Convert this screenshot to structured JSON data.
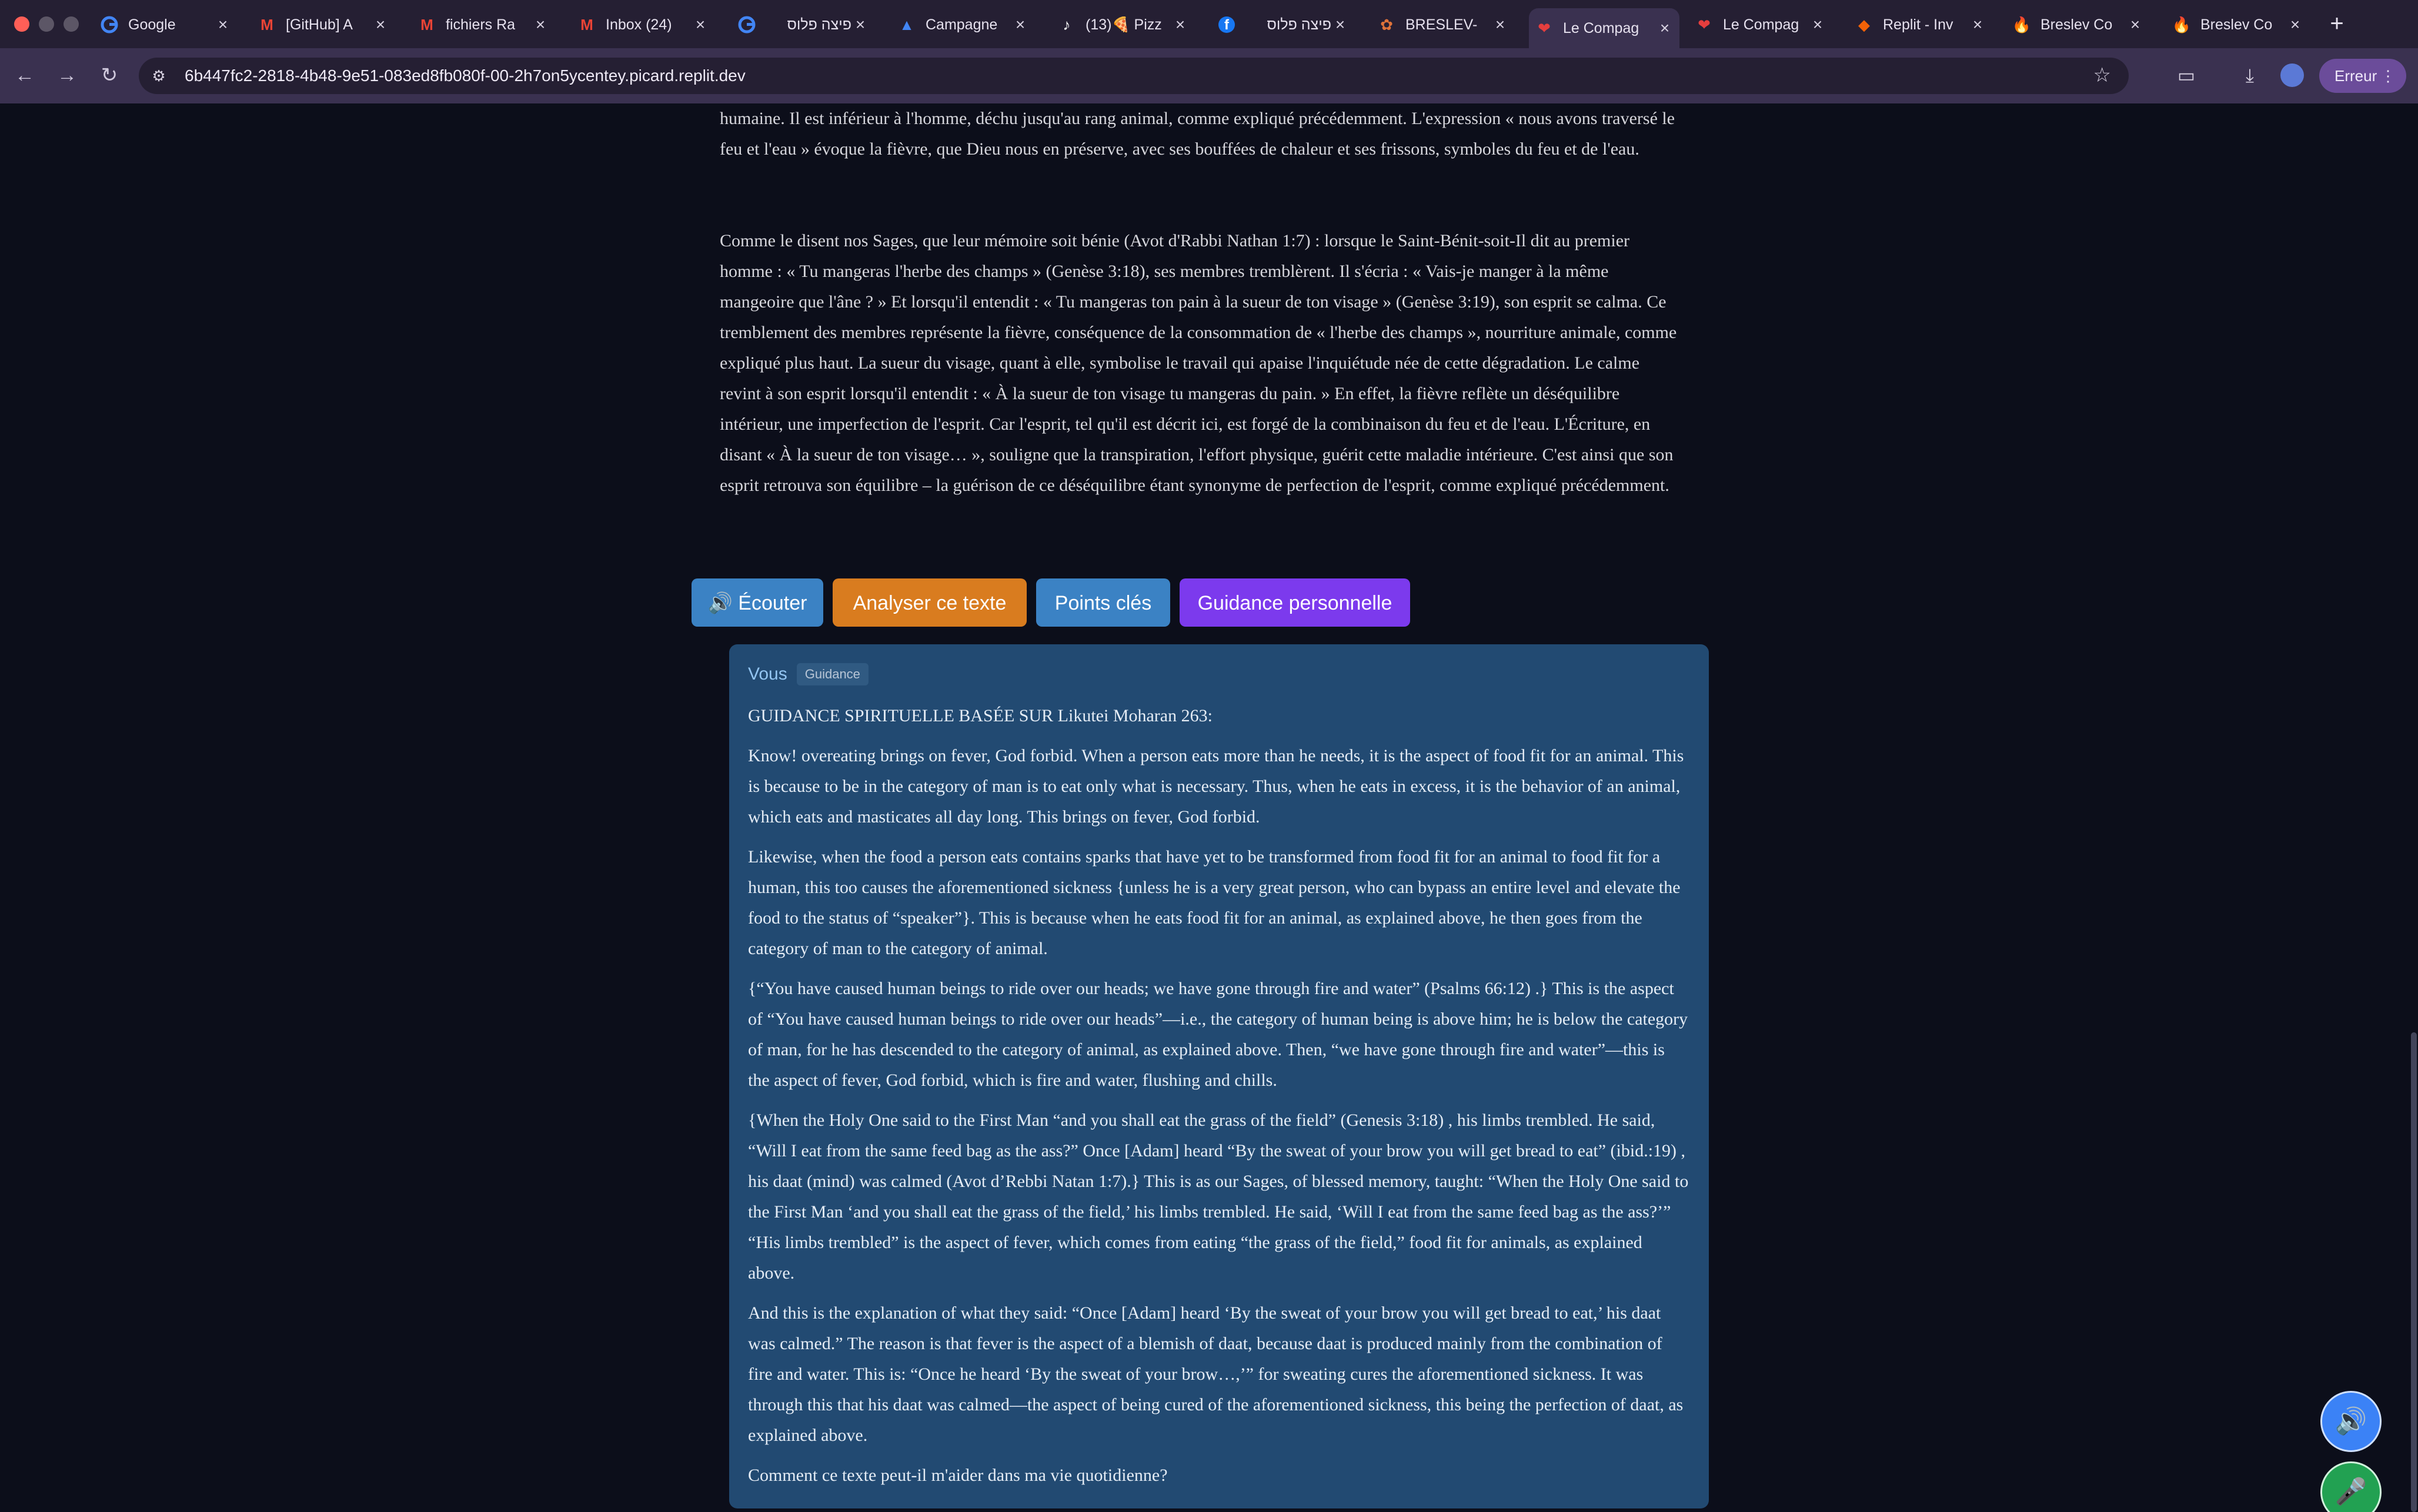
{
  "browser": {
    "tabs": [
      {
        "title": "Google",
        "icon": "google-icon",
        "active": false
      },
      {
        "title": "[GitHub] A",
        "icon": "gmail-icon",
        "active": false
      },
      {
        "title": "fichiers Ra",
        "icon": "gmail-icon",
        "active": false
      },
      {
        "title": "Inbox (24)",
        "icon": "gmail-icon",
        "active": false
      },
      {
        "title": "פיצה פלוס",
        "icon": "google-icon",
        "active": false
      },
      {
        "title": "Campagne",
        "icon": "google-ads-icon",
        "active": false
      },
      {
        "title": "(13)🍕 Pizz",
        "icon": "tiktok-icon",
        "active": false
      },
      {
        "title": "פיצה פלוס",
        "icon": "facebook-icon",
        "active": false
      },
      {
        "title": "BRESLEV-",
        "icon": "breslev-icon",
        "active": false
      },
      {
        "title": "Le Compag",
        "icon": "heart-icon",
        "active": true
      },
      {
        "title": "Le Compag",
        "icon": "heart-icon",
        "active": false
      },
      {
        "title": "Replit - Inv",
        "icon": "replit-icon",
        "active": false
      },
      {
        "title": "Breslev Co",
        "icon": "flame-icon",
        "active": false
      },
      {
        "title": "Breslev Co",
        "icon": "flame-icon",
        "active": false
      }
    ],
    "url": "6b447fc2-2818-4b48-9e51-083ed8fb080f-00-2h7on5ycentey.picard.replit.dev",
    "error_label": "Erreur"
  },
  "source_text": {
    "paragraph_top": "humaine. Il est inférieur à l'homme, déchu jusqu'au rang animal, comme expliqué précédemment.  L'expression « nous avons traversé le feu et l'eau » évoque la fièvre, que Dieu nous en préserve, avec ses bouffées de chaleur et ses frissons,  symboles du feu et de l'eau.",
    "paragraph_main": "Comme le disent nos Sages, que leur mémoire soit bénie (Avot d'Rabbi Nathan 1:7) : lorsque le Saint-Bénit-soit-Il dit au premier homme : « Tu mangeras l'herbe des champs » (Genèse 3:18), ses membres tremblèrent. Il s'écria : « Vais-je manger à la même mangeoire que l'âne ? »  Et lorsqu'il entendit : « Tu mangeras ton pain à la sueur de ton visage » (Genèse 3:19), son esprit se calma.  Ce tremblement des membres représente la fièvre, conséquence de la consommation de « l'herbe des champs », nourriture animale, comme expliqué plus haut.  La sueur du visage, quant à elle, symbolise le travail qui apaise l'inquiétude née de cette dégradation. Le calme revint à son esprit lorsqu'il entendit : « À la sueur de ton visage tu mangeras du pain. »  En effet, la fièvre reflète un déséquilibre intérieur, une imperfection de l'esprit.  Car l'esprit, tel qu'il est décrit ici, est forgé de la combinaison du feu et de l'eau.  L'Écriture, en disant « À la sueur de ton visage… », souligne que la transpiration, l'effort physique, guérit cette maladie intérieure.  C'est ainsi que son esprit retrouva son équilibre –  la guérison de ce déséquilibre étant synonyme de perfection de l'esprit, comme expliqué précédemment."
  },
  "actions": {
    "listen": "🔊 Écouter",
    "analyze": "Analyser ce texte",
    "key_points": "Points clés",
    "guidance": "Guidance personnelle"
  },
  "chat": {
    "author": "Vous",
    "badge": "Guidance",
    "heading": "GUIDANCE SPIRITUELLE BASÉE SUR Likutei Moharan 263:",
    "paragraphs": [
      "Know! overeating brings on fever, God forbid. When a person eats more than he needs, it is the aspect of food fit for an animal. This is because to be in the category of man is to eat only what is necessary. Thus, when he eats in excess, it is the behavior of an animal, which eats and masticates all day long. This brings on fever, God forbid.",
      "Likewise, when the food a person eats contains sparks that have yet to be transformed from food fit for an animal to food fit for a human, this too causes the aforementioned sickness {unless he is a very great person, who can bypass an entire level and elevate the food to the status of “speaker”}. This is because when he eats food fit for an animal, as explained above, he then goes from the category of man to the category of animal.",
      "{“You have caused human beings to ride over our heads; we have gone through fire and water” (Psalms 66:12) .} This is the aspect of “You have caused human beings to ride over our heads”—i.e., the category of human being is above him; he is below the category of man, for he has descended to the category of animal, as explained above. Then, “we have gone through fire and water”—this is the aspect of fever, God forbid, which is fire and water, flushing and chills.",
      "{When the Holy One said to the First Man “and you shall eat the grass of the field” (Genesis 3:18) , his limbs trembled. He said, “Will I eat from the same feed bag as the ass?” Once [Adam] heard “By the sweat of your brow you will get bread to eat” (ibid.:19) , his daat (mind) was calmed (Avot d’Rebbi Natan 1:7).} This is as our Sages, of blessed memory, taught: “When the Holy One said to the First Man ‘and you shall eat the grass of the field,’ his limbs trembled. He said, ‘Will I eat from the same feed bag as the ass?’” “His limbs trembled” is the aspect of fever, which comes from eating “the grass of the field,” food fit for animals, as explained above.",
      "And this is the explanation of what they said: “Once [Adam] heard ‘By the sweat of your brow you will get bread to eat,’ his daat was calmed.” The reason is that fever is the aspect of a blemish of daat, because daat is produced mainly from the combination of fire and water. This is: “Once he heard ‘By the sweat of your brow…,’” for sweating cures the aforementioned sickness. It was through this that his daat was calmed—the aspect of being cured of the aforementioned sickness, this being the perfection of daat, as explained above.",
      "Comment ce texte peut-il m'aider dans ma vie quotidienne?"
    ]
  },
  "fabs": {
    "speaker_icon": "speaker-icon",
    "mic_icon": "microphone-icon"
  },
  "colors": {
    "listen": "#3b82c4",
    "analyze": "#d97c1f",
    "key_points": "#3b82c4",
    "guidance": "#7c3aed",
    "card": "#224a72",
    "fab_speaker": "#3b82f6",
    "fab_mic": "#22a152"
  }
}
